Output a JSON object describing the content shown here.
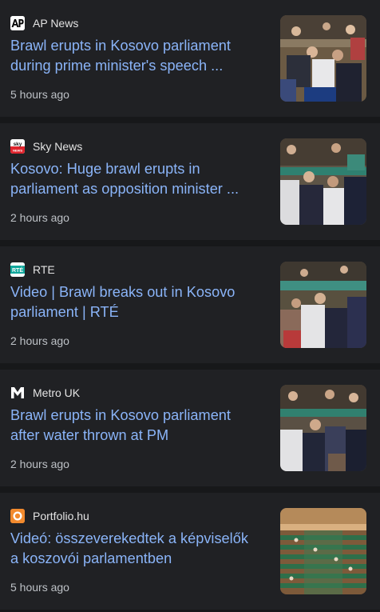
{
  "articles": [
    {
      "source": "AP News",
      "logo_icon": "ap-news-logo",
      "headline": "Brawl erupts in Kosovo parliament during prime minister's speech ...",
      "time": "5 hours ago"
    },
    {
      "source": "Sky News",
      "logo_icon": "sky-news-logo",
      "headline": "Kosovo: Huge brawl erupts in parliament as opposition minister ...",
      "time": "2 hours ago"
    },
    {
      "source": "RTE",
      "logo_icon": "rte-logo",
      "headline": "Video | Brawl breaks out in Kosovo parliament | RTÉ",
      "time": "2 hours ago"
    },
    {
      "source": "Metro UK",
      "logo_icon": "metro-uk-logo",
      "headline": "Brawl erupts in Kosovo parliament after water thrown at PM",
      "time": "2 hours ago"
    },
    {
      "source": "Portfolio.hu",
      "logo_icon": "portfolio-hu-logo",
      "headline": "Videó: összeverekedtek a képviselők a koszovói parlamentben",
      "time": "5 hours ago"
    }
  ],
  "colors": {
    "background": "#17181a",
    "card": "#202124",
    "headline": "#8ab4f8",
    "source_text": "#e3e3e3",
    "time_text": "#bdc1c6"
  }
}
